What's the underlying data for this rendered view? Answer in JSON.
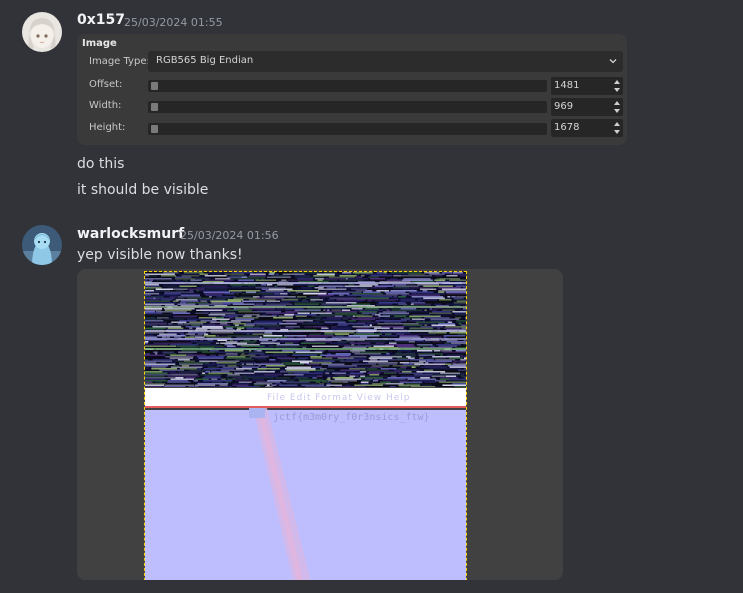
{
  "messages": [
    {
      "author": "0x157",
      "timestamp": "25/03/2024 01:55",
      "embedded_dialog": {
        "title": "Image",
        "image_type_label": "Image Type:",
        "image_type_value": "RGB565 Big Endian",
        "offset_label": "Offset:",
        "offset_value": "1481",
        "width_label": "Width:",
        "width_value": "969",
        "height_label": "Height:",
        "height_value": "1678"
      },
      "lines": [
        "do this",
        "it should be visible"
      ]
    },
    {
      "author": "warlocksmurf",
      "timestamp": "25/03/2024 01:56",
      "lines": [
        "yep visible now thanks!"
      ],
      "attachment": {
        "menu_text": "File  Edit  Format  View  Help",
        "flag_text": "jctf{m3m0ry_f0r3nsics_ftw}"
      }
    }
  ],
  "colors": {
    "background": "#313338",
    "author": "#f2f3f5",
    "timestamp": "#949ba4",
    "selection_border": "#ffd700",
    "recovered_image_bg": "#bebefe"
  }
}
